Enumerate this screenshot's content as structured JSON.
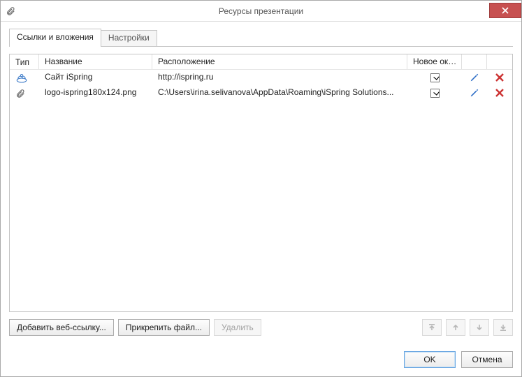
{
  "window": {
    "title": "Ресурсы презентации"
  },
  "tabs": [
    {
      "label": "Ссылки и вложения",
      "active": true
    },
    {
      "label": "Настройки",
      "active": false
    }
  ],
  "columns": {
    "type": "Тип",
    "name": "Название",
    "location": "Расположение",
    "new_window": "Новое окно"
  },
  "rows": [
    {
      "type_icon": "link-icon",
      "name": "Сайт iSpring",
      "location": "http://ispring.ru",
      "new_window": true
    },
    {
      "type_icon": "paperclip-icon",
      "name": "logo-ispring180x124.png",
      "location": "C:\\Users\\irina.selivanova\\AppData\\Roaming\\iSpring Solutions...",
      "new_window": true
    }
  ],
  "toolbar": {
    "add_link": "Добавить веб-ссылку...",
    "attach_file": "Прикрепить файл...",
    "delete": "Удалить"
  },
  "footer": {
    "ok": "OK",
    "cancel": "Отмена"
  },
  "icons": {
    "title_clip": "paperclip-icon",
    "close": "close-icon",
    "edit": "pencil-icon",
    "delete_row": "x-delete-icon",
    "move_top": "move-top-icon",
    "move_up": "move-up-icon",
    "move_down": "move-down-icon",
    "move_bottom": "move-bottom-icon"
  }
}
